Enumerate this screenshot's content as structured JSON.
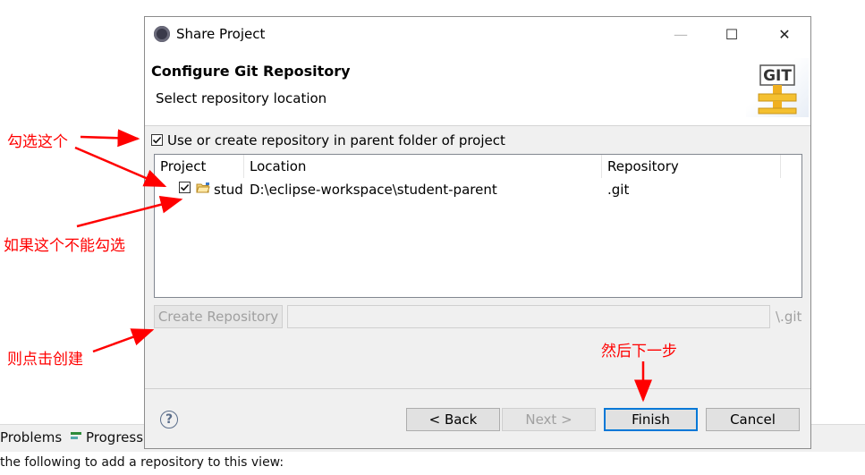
{
  "background": {
    "tabs": [
      {
        "label": "Problems",
        "icon": "problems-icon"
      },
      {
        "label": "Progress",
        "icon": "progress-icon"
      }
    ],
    "hint_text": "the following to add a repository to this view:"
  },
  "dialog": {
    "title": "Share Project",
    "window_controls": {
      "minimize": "—",
      "maximize": "☐",
      "close": "✕"
    },
    "banner": {
      "title": "Configure Git Repository",
      "subtitle": "Select repository location",
      "logo_text": "GIT"
    },
    "use_parent_checkbox": {
      "label": "Use or create repository in parent folder of project",
      "checked": true
    },
    "table": {
      "columns": [
        "Project",
        "Location",
        "Repository"
      ],
      "rows": [
        {
          "checked": true,
          "project": "stud",
          "location": "D:\\eclipse-workspace\\student-parent",
          "repository": ".git"
        }
      ]
    },
    "create_repository_button": "Create Repository",
    "path_input_value": "",
    "git_suffix": "\\.git",
    "help_symbol": "?",
    "buttons": {
      "back": "< Back",
      "next": "Next >",
      "finish": "Finish",
      "cancel": "Cancel"
    }
  },
  "annotations": {
    "check_this": "勾选这个",
    "if_cannot_check": "如果这个不能勾选",
    "then_click_create": "则点击创建",
    "then_next": "然后下一步"
  },
  "colors": {
    "annotation": "#ff0000",
    "default_button_border": "#0078d7",
    "dialog_bg": "#f0f0f0"
  }
}
